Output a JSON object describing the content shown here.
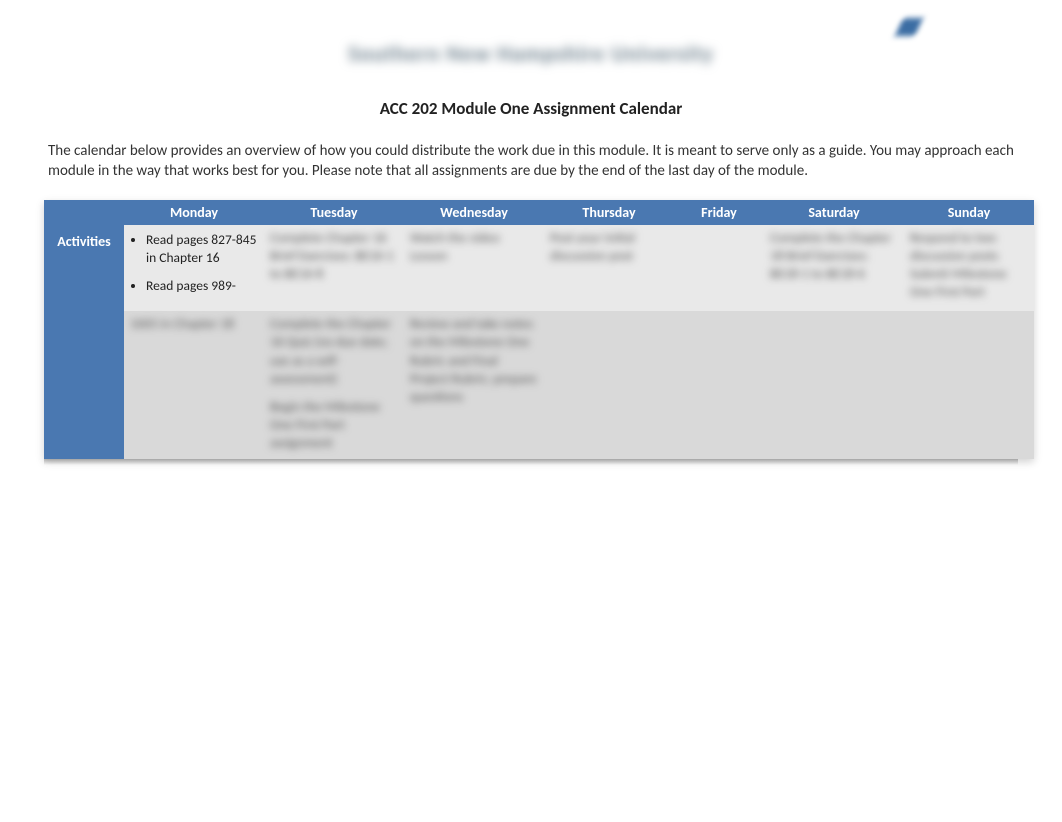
{
  "logo_text": "Southern New Hampshire University",
  "title": "ACC 202 Module One Assignment Calendar",
  "intro": "The calendar below provides an overview of how you could distribute the work due in this module. It is meant to serve only as a guide. You may approach each module in the way that works best for you. Please note that all assignments are due by the end of the last day of the module.",
  "corner": "",
  "days": {
    "mon": "Monday",
    "tue": "Tuesday",
    "wed": "Wednesday",
    "thu": "Thursday",
    "fri": "Friday",
    "sat": "Saturday",
    "sun": "Sunday"
  },
  "row_label": "Activities",
  "cells": {
    "mon": {
      "items": [
        "Read pages 827-845 in Chapter 16",
        "Read pages 989-"
      ],
      "blur_tail": "1005 in Chapter 18"
    },
    "tue": {
      "blur1": "Complete Chapter 16 Brief Exercises: BE16-1 to BE16-8",
      "blur2": "Complete the Chapter 16 Quiz (no due date; use as a self-assessment)",
      "blur3": "Begin the Milestone One First Part assignment"
    },
    "wed": {
      "blur1": "Watch the video Lesson",
      "blur2": "Review and take notes on the Milestone One Rubric and Final Project Rubric; prepare questions"
    },
    "thu": {
      "blur1": "Post your initial discussion post"
    },
    "fri": {
      "blur1": ""
    },
    "sat": {
      "blur1": "Complete the Chapter 18 Brief Exercises: BE18-1 to BE18-6"
    },
    "sun": {
      "blur1": "Respond to two discussion posts",
      "blur2": "Submit Milestone One First Part"
    }
  }
}
